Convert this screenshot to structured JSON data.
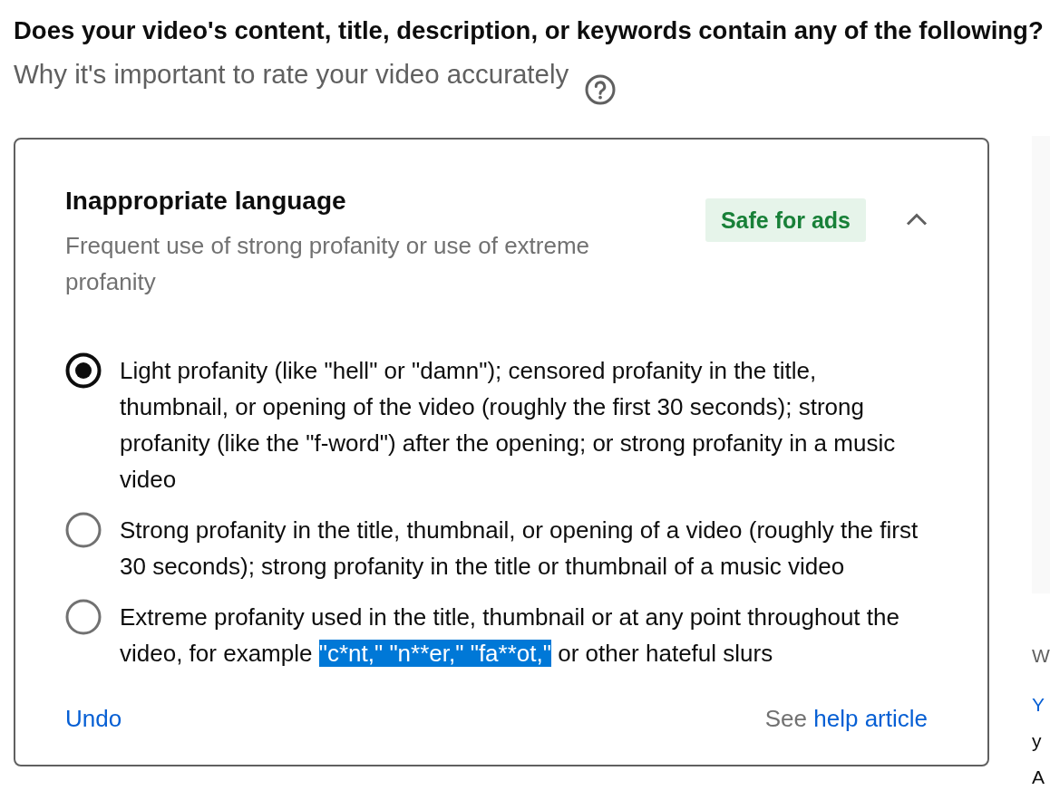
{
  "question": {
    "title": "Does your video's content, title, description, or keywords contain any of the following?",
    "help_text": "Why it's important to rate your video accurately"
  },
  "card": {
    "title": "Inappropriate language",
    "description": "Frequent use of strong profanity or use of extreme profanity",
    "badge": "Safe for ads",
    "expanded": true,
    "options": [
      {
        "selected": true,
        "segments": [
          {
            "text": "Light profanity (like \"hell\" or \"damn\"); censored profanity in the title, thumbnail, or opening of the video (roughly the first 30 seconds); strong profanity (like the \"f-word\") after the opening; or strong profanity in a music video",
            "highlighted": false
          }
        ]
      },
      {
        "selected": false,
        "segments": [
          {
            "text": "Strong profanity in the title, thumbnail, or opening of a video (roughly the first 30 seconds); strong profanity in the title or thumbnail of a music video",
            "highlighted": false
          }
        ]
      },
      {
        "selected": false,
        "segments": [
          {
            "text": "Extreme profanity used in the title, thumbnail or at any point throughout the video, for example ",
            "highlighted": false
          },
          {
            "text": "\"c*nt,\" \"n**er,\" \"fa**ot,\"",
            "highlighted": true
          },
          {
            "text": " or other hateful slurs",
            "highlighted": false
          }
        ]
      }
    ],
    "undo": "Undo",
    "help": {
      "prefix": "See",
      "link": "help article"
    }
  },
  "side_panel": {
    "texts": [
      {
        "kind": "label",
        "text": "W"
      },
      {
        "kind": "link",
        "text": "Y"
      },
      {
        "kind": "body",
        "text": "y"
      },
      {
        "kind": "body",
        "text": "A"
      }
    ]
  }
}
